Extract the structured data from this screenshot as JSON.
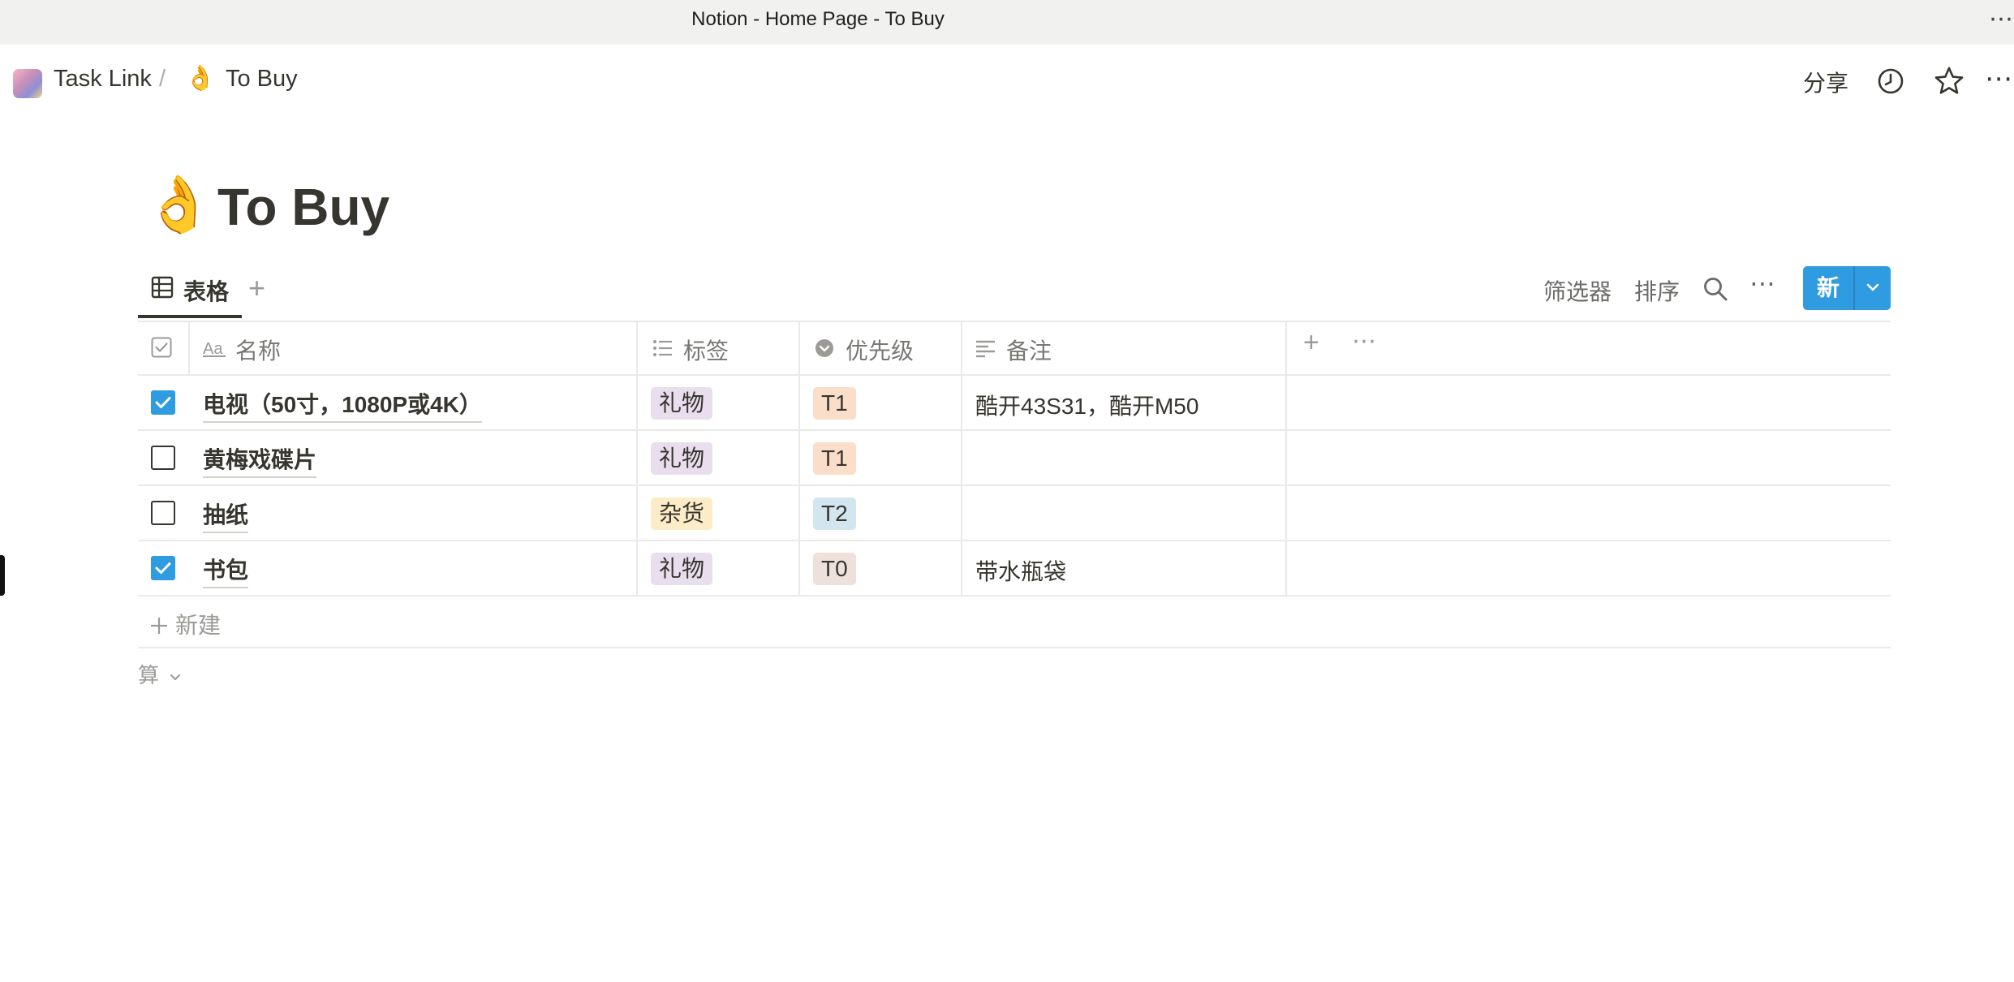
{
  "window": {
    "title": "Notion - Home Page - To Buy",
    "more_glyph": "⋯"
  },
  "breadcrumb": {
    "workspace": "Task Link",
    "separator": "/",
    "page_emoji": "👌",
    "page": "To Buy"
  },
  "topbar": {
    "share": "分享",
    "more_glyph": "⋯"
  },
  "page": {
    "emoji": "👌",
    "title": "To Buy"
  },
  "view": {
    "tab_label": "表格",
    "add_glyph": "+",
    "filter": "筛选器",
    "sort": "排序",
    "more_glyph": "⋯",
    "new_button": "新"
  },
  "table": {
    "columns": [
      {
        "label": "名称",
        "icon": "text-aa-icon"
      },
      {
        "label": "标签",
        "icon": "multi-select-icon"
      },
      {
        "label": "优先级",
        "icon": "select-icon"
      },
      {
        "label": "备注",
        "icon": "text-lines-icon"
      }
    ],
    "add_column_glyph": "+",
    "more_glyph": "⋯",
    "rows": [
      {
        "checked": true,
        "name": "电视（50寸，1080P或4K）",
        "tag": "礼物",
        "tag_color": "#e8deee",
        "priority": "T1",
        "priority_color": "#fadec9",
        "note": "酷开43S31，酷开M50"
      },
      {
        "checked": false,
        "name": "黄梅戏碟片",
        "tag": "礼物",
        "tag_color": "#e8deee",
        "priority": "T1",
        "priority_color": "#fadec9",
        "note": ""
      },
      {
        "checked": false,
        "name": "抽纸",
        "tag": "杂货",
        "tag_color": "#fdecc8",
        "priority": "T2",
        "priority_color": "#d3e5ef",
        "note": ""
      },
      {
        "checked": true,
        "name": "书包",
        "tag": "礼物",
        "tag_color": "#e8deee",
        "priority": "T0",
        "priority_color": "#eee0da",
        "note": "带水瓶袋"
      }
    ],
    "new_row": "新建",
    "calculate": "算"
  },
  "colors": {
    "accent": "#2f9be0",
    "text": "#37352f",
    "muted": "#787774",
    "border": "#e9e9e7"
  }
}
